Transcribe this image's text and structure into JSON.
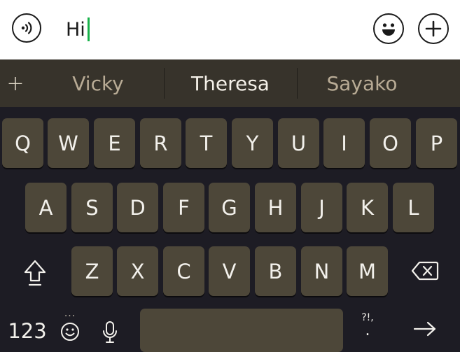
{
  "input_bar": {
    "text": "Hi",
    "voice_icon": "audio-message-icon",
    "emoji_icon": "emoji-icon",
    "plus_icon": "plus-icon"
  },
  "suggestions": {
    "plus_icon": "plus-icon",
    "items": [
      "Vicky",
      "Theresa",
      "Sayako"
    ],
    "highlighted_index": 1
  },
  "keyboard": {
    "row1": [
      "Q",
      "W",
      "E",
      "R",
      "T",
      "Y",
      "U",
      "I",
      "O",
      "P"
    ],
    "row2": [
      "A",
      "S",
      "D",
      "F",
      "G",
      "H",
      "J",
      "K",
      "L"
    ],
    "row3": [
      "Z",
      "X",
      "C",
      "V",
      "B",
      "N",
      "M"
    ],
    "shift_icon": "shift-icon",
    "backspace_icon": "backspace-icon",
    "numbers_label": "123",
    "more_dots": "...",
    "emoji_icon": "emoji-icon",
    "mic_icon": "microphone-icon",
    "punct_label": "?!,",
    "punct_dot": ".",
    "return_icon": "arrow-right-icon"
  },
  "colors": {
    "caret": "#18b24a",
    "keyboard_bg": "#1d1c24",
    "key_bg": "#4d4739",
    "suggestion_bg": "#37332b"
  }
}
